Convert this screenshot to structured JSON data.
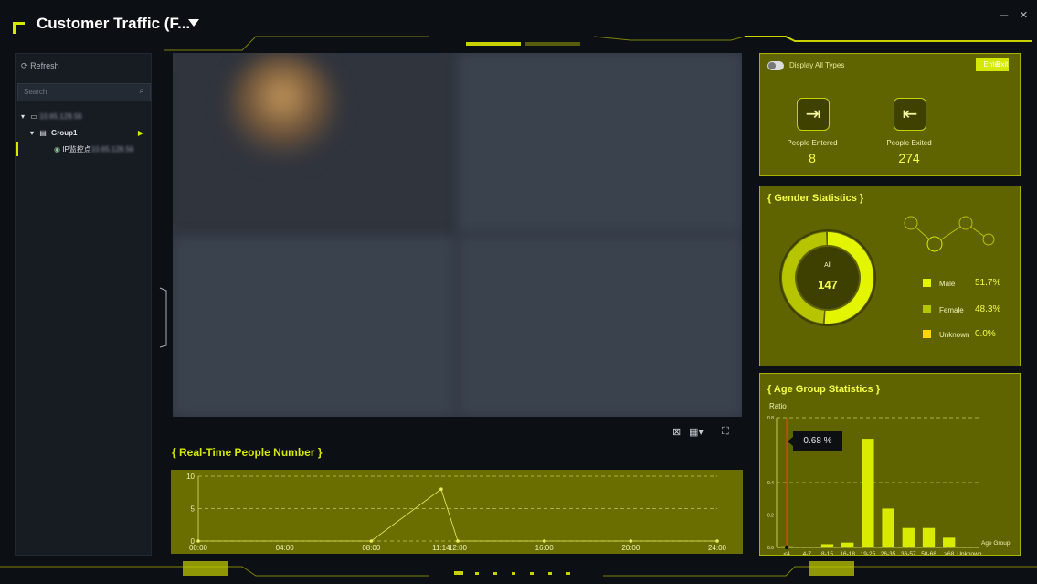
{
  "window": {
    "title": "Customer Traffic (F...",
    "minimize": "–",
    "close": "×"
  },
  "sidebar": {
    "refresh_label": "Refresh",
    "search_placeholder": "Search",
    "device_ip": "10.65.128.56",
    "group_label": "Group1",
    "camera_label": "IP监控点",
    "camera_suffix": "10.65.128.56"
  },
  "realtime": {
    "title": "{ Real-Time People Number }",
    "y_ticks": [
      "10",
      "5",
      "0"
    ],
    "x_ticks": [
      "00:00",
      "04:00",
      "08:00",
      "11:14",
      "12:00",
      "16:00",
      "20:00",
      "24:00"
    ]
  },
  "counts": {
    "toggle_label": "Display All Types",
    "enter_tab": "Enter",
    "exit_tab": "Exit",
    "entered_label": "People Entered",
    "entered_value": "8",
    "exited_label": "People Exited",
    "exited_value": "274"
  },
  "gender": {
    "title": "{ Gender Statistics }",
    "center_label": "All",
    "total": "147",
    "items": [
      {
        "label": "Male",
        "value": "51.7%",
        "color": "#e3f500"
      },
      {
        "label": "Female",
        "value": "48.3%",
        "color": "#b7c400"
      },
      {
        "label": "Unknown",
        "value": "0.0%",
        "color": "#ffd400"
      }
    ]
  },
  "age": {
    "title": "{ Age Group Statistics }",
    "ylabel": "Ratio",
    "xlabel": "Age Group",
    "y_ticks": [
      "0.8",
      "0.4",
      "0.2",
      "0.0"
    ],
    "tooltip": "0.68 %"
  },
  "chart_data": [
    {
      "type": "line",
      "title": "{ Real-Time People Number }",
      "x": [
        "00:00",
        "08:00",
        "11:14",
        "12:00",
        "16:00",
        "20:00",
        "24:00"
      ],
      "y": [
        0,
        0,
        8,
        0,
        0,
        0,
        0
      ],
      "ylim": [
        0,
        10
      ],
      "grid": true
    },
    {
      "type": "bar",
      "title": "{ Age Group Statistics }",
      "ylabel": "Ratio",
      "xlabel": "Age Group",
      "categories": [
        "<4",
        "4-7",
        "8-15",
        "16-18",
        "19-25",
        "26-35",
        "36-57",
        "58-68",
        ">68",
        "Unknown"
      ],
      "values": [
        0.0068,
        0.0,
        0.02,
        0.03,
        0.67,
        0.24,
        0.12,
        0.12,
        0.06,
        0.0
      ],
      "ylim": [
        0,
        0.8
      ]
    },
    {
      "type": "pie",
      "title": "{ Gender Statistics }",
      "categories": [
        "Male",
        "Female",
        "Unknown"
      ],
      "values": [
        51.7,
        48.3,
        0.0
      ]
    }
  ]
}
